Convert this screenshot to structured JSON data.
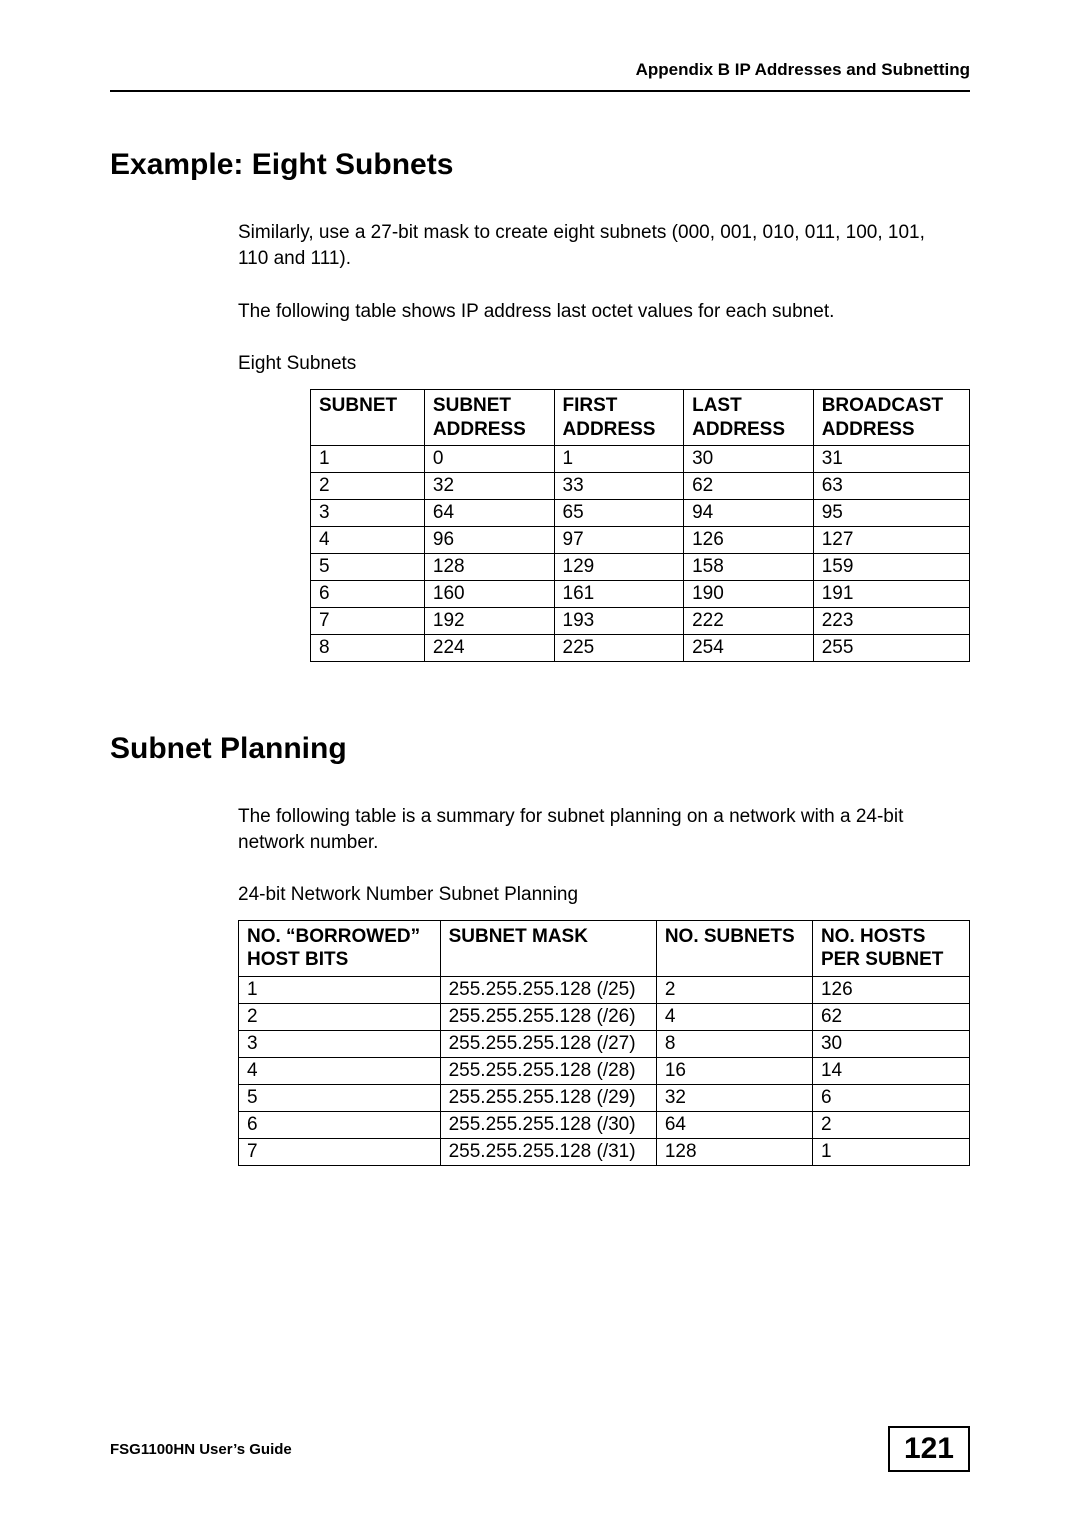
{
  "header": {
    "running_title": "Appendix B IP Addresses and Subnetting"
  },
  "section1": {
    "title": "Example: Eight Subnets",
    "para1": "Similarly, use a 27-bit mask to create eight subnets (000, 001, 010, 011, 100, 101, 110 and 111).",
    "para2": "The following table shows IP address last octet values for each subnet.",
    "caption": "Eight Subnets",
    "table": {
      "head": [
        "SUBNET",
        "SUBNET ADDRESS",
        "FIRST ADDRESS",
        "LAST ADDRESS",
        "BROADCAST ADDRESS"
      ],
      "rows": [
        [
          "1",
          "0",
          "1",
          "30",
          "31"
        ],
        [
          "2",
          "32",
          "33",
          "62",
          "63"
        ],
        [
          "3",
          "64",
          "65",
          "94",
          "95"
        ],
        [
          "4",
          "96",
          "97",
          "126",
          "127"
        ],
        [
          "5",
          "128",
          "129",
          "158",
          "159"
        ],
        [
          "6",
          "160",
          "161",
          "190",
          "191"
        ],
        [
          "7",
          "192",
          "193",
          "222",
          "223"
        ],
        [
          "8",
          "224",
          "225",
          "254",
          "255"
        ]
      ]
    }
  },
  "section2": {
    "title": "Subnet Planning",
    "para1": "The following table is a summary for subnet planning on a network with a 24-bit network number.",
    "caption": "24-bit Network Number Subnet Planning",
    "table": {
      "head": [
        "NO. “BORROWED” HOST BITS",
        "SUBNET MASK",
        "NO. SUBNETS",
        "NO. HOSTS PER SUBNET"
      ],
      "rows": [
        [
          "1",
          "255.255.255.128 (/25)",
          "2",
          "126"
        ],
        [
          "2",
          "255.255.255.128 (/26)",
          "4",
          "62"
        ],
        [
          "3",
          "255.255.255.128 (/27)",
          "8",
          "30"
        ],
        [
          "4",
          "255.255.255.128 (/28)",
          "16",
          "14"
        ],
        [
          "5",
          "255.255.255.128 (/29)",
          "32",
          "6"
        ],
        [
          "6",
          "255.255.255.128 (/30)",
          "64",
          "2"
        ],
        [
          "7",
          "255.255.255.128 (/31)",
          "128",
          "1"
        ]
      ]
    }
  },
  "footer": {
    "guide": "FSG1100HN User’s Guide",
    "page": "121"
  }
}
